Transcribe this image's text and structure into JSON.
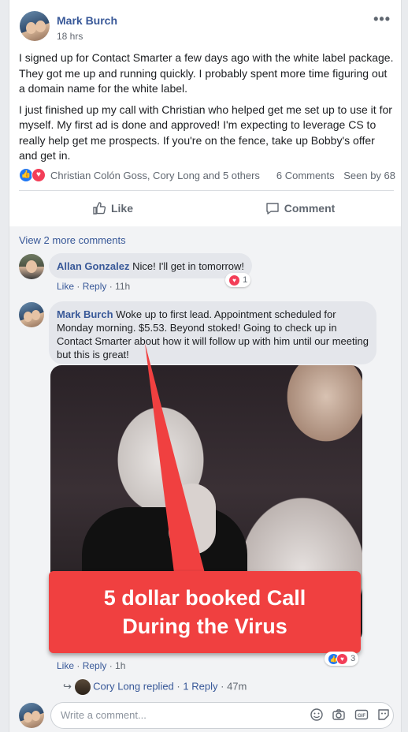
{
  "post": {
    "author": "Mark Burch",
    "time": "18 hrs",
    "more_label": "•••",
    "paragraphs": [
      "I signed up for Contact Smarter a few days ago with the white label package. They got me up and running quickly. I probably spent more time figuring out a domain name for the white label.",
      "I just finished up my call with Christian who helped get me set up to use it for myself. My first ad is done and approved! I'm expecting to leverage CS to really help get me prospects. If you're on the fence, take up Bobby's offer and get in."
    ],
    "reactors": "Christian Colón Goss, Cory Long and 5 others",
    "comments_count": "6 Comments",
    "seen_by": "Seen by 68",
    "like_label": "Like",
    "comment_label": "Comment"
  },
  "comments": {
    "view_more": "View 2 more comments",
    "items": [
      {
        "author": "Allan Gonzalez",
        "text": "Nice! I'll get in tomorrow!",
        "like": "Like",
        "reply": "Reply",
        "time": "11h",
        "reaction_count": "1"
      },
      {
        "author": "Mark Burch",
        "text": "Woke up to first lead. Appointment scheduled for Monday morning. $5.53. Beyond stoked! Going to check up in Contact Smarter about how it will follow up with him until our meeting but this is great!",
        "like": "Like",
        "reply": "Reply",
        "time": "1h",
        "reaction_count": "3"
      }
    ],
    "reply_summary": {
      "name": "Cory Long",
      "action": "replied",
      "count": "1 Reply",
      "time": "47m"
    },
    "write_placeholder": "Write a comment..."
  },
  "banner": {
    "line1": "5 dollar booked Call",
    "line2": "During the Virus"
  },
  "colors": {
    "link": "#385898",
    "like_blue": "#2078f4",
    "love_red": "#f33e58",
    "banner_red": "#f04040"
  }
}
